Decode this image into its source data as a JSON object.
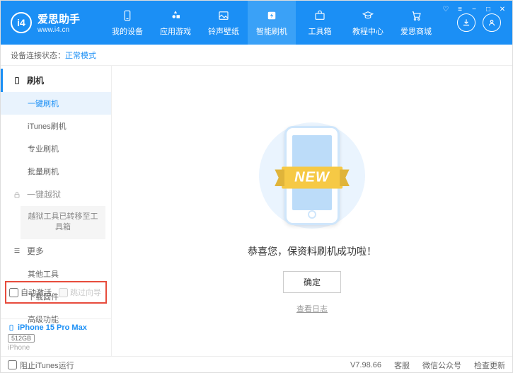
{
  "brand": {
    "name": "爱思助手",
    "url": "www.i4.cn"
  },
  "nav": [
    {
      "label": "我的设备"
    },
    {
      "label": "应用游戏"
    },
    {
      "label": "铃声壁纸"
    },
    {
      "label": "智能刷机"
    },
    {
      "label": "工具箱"
    },
    {
      "label": "教程中心"
    },
    {
      "label": "爱思商城"
    }
  ],
  "status": {
    "prefix": "设备连接状态：",
    "mode": "正常模式"
  },
  "sidebar": {
    "flash_header": "刷机",
    "items": {
      "onekey": "一键刷机",
      "itunes": "iTunes刷机",
      "pro": "专业刷机",
      "batch": "批量刷机"
    },
    "jailbreak_header": "一键越狱",
    "jailbreak_notice": "越狱工具已转移至工具箱",
    "more_header": "更多",
    "more": {
      "other": "其他工具",
      "download": "下载固件",
      "advanced": "高级功能"
    },
    "auto_activate": "自动激活",
    "skip_guide": "跳过向导"
  },
  "device": {
    "name": "iPhone 15 Pro Max",
    "storage": "512GB",
    "type": "iPhone"
  },
  "content": {
    "ribbon": "NEW",
    "message": "恭喜您，保资料刷机成功啦！",
    "ok": "确定",
    "log": "查看日志"
  },
  "footer": {
    "block_itunes": "阻止iTunes运行",
    "version": "V7.98.66",
    "support": "客服",
    "wechat": "微信公众号",
    "update": "检查更新"
  }
}
